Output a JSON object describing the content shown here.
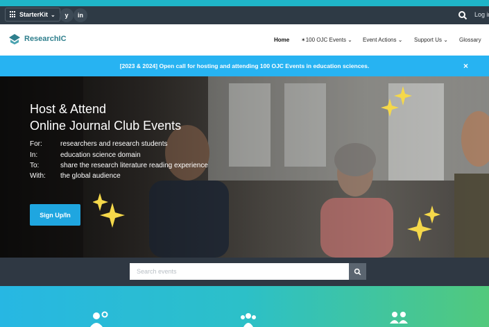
{
  "topbar": {
    "starterkit_label": "StarterKit",
    "social": [
      {
        "name": "twitter-icon",
        "glyph": "y"
      },
      {
        "name": "linkedin-icon",
        "glyph": "in"
      }
    ],
    "login_label": "Log in"
  },
  "navbar": {
    "logo_text": "ResearchIC",
    "items": [
      {
        "label": "Home",
        "active": true
      },
      {
        "label": "✴100 OJC Events ⌄"
      },
      {
        "label": "Event Actions ⌄"
      },
      {
        "label": "Support Us ⌄"
      },
      {
        "label": "Glossary"
      }
    ]
  },
  "announcement": {
    "text": "[2023 & 2024] Open call for hosting and attending 100 OJC Events in education sciences.",
    "close": "×"
  },
  "hero": {
    "title_line1": "Host & Attend",
    "title_line2": "Online Journal Club Events",
    "details": [
      {
        "key": "For:",
        "value": "researchers and research students"
      },
      {
        "key": "In:",
        "value": "education science domain"
      },
      {
        "key": "To:",
        "value": "share the research literature reading experience"
      },
      {
        "key": "With:",
        "value": "the global audience"
      }
    ],
    "cta_label": "Sign Up/In"
  },
  "search": {
    "placeholder": "Search events"
  },
  "colors": {
    "topbar": "#2e3a45",
    "announcement": "#27b3f2",
    "accent": "#1fa6e0",
    "sparkle": "#f5d84a"
  }
}
